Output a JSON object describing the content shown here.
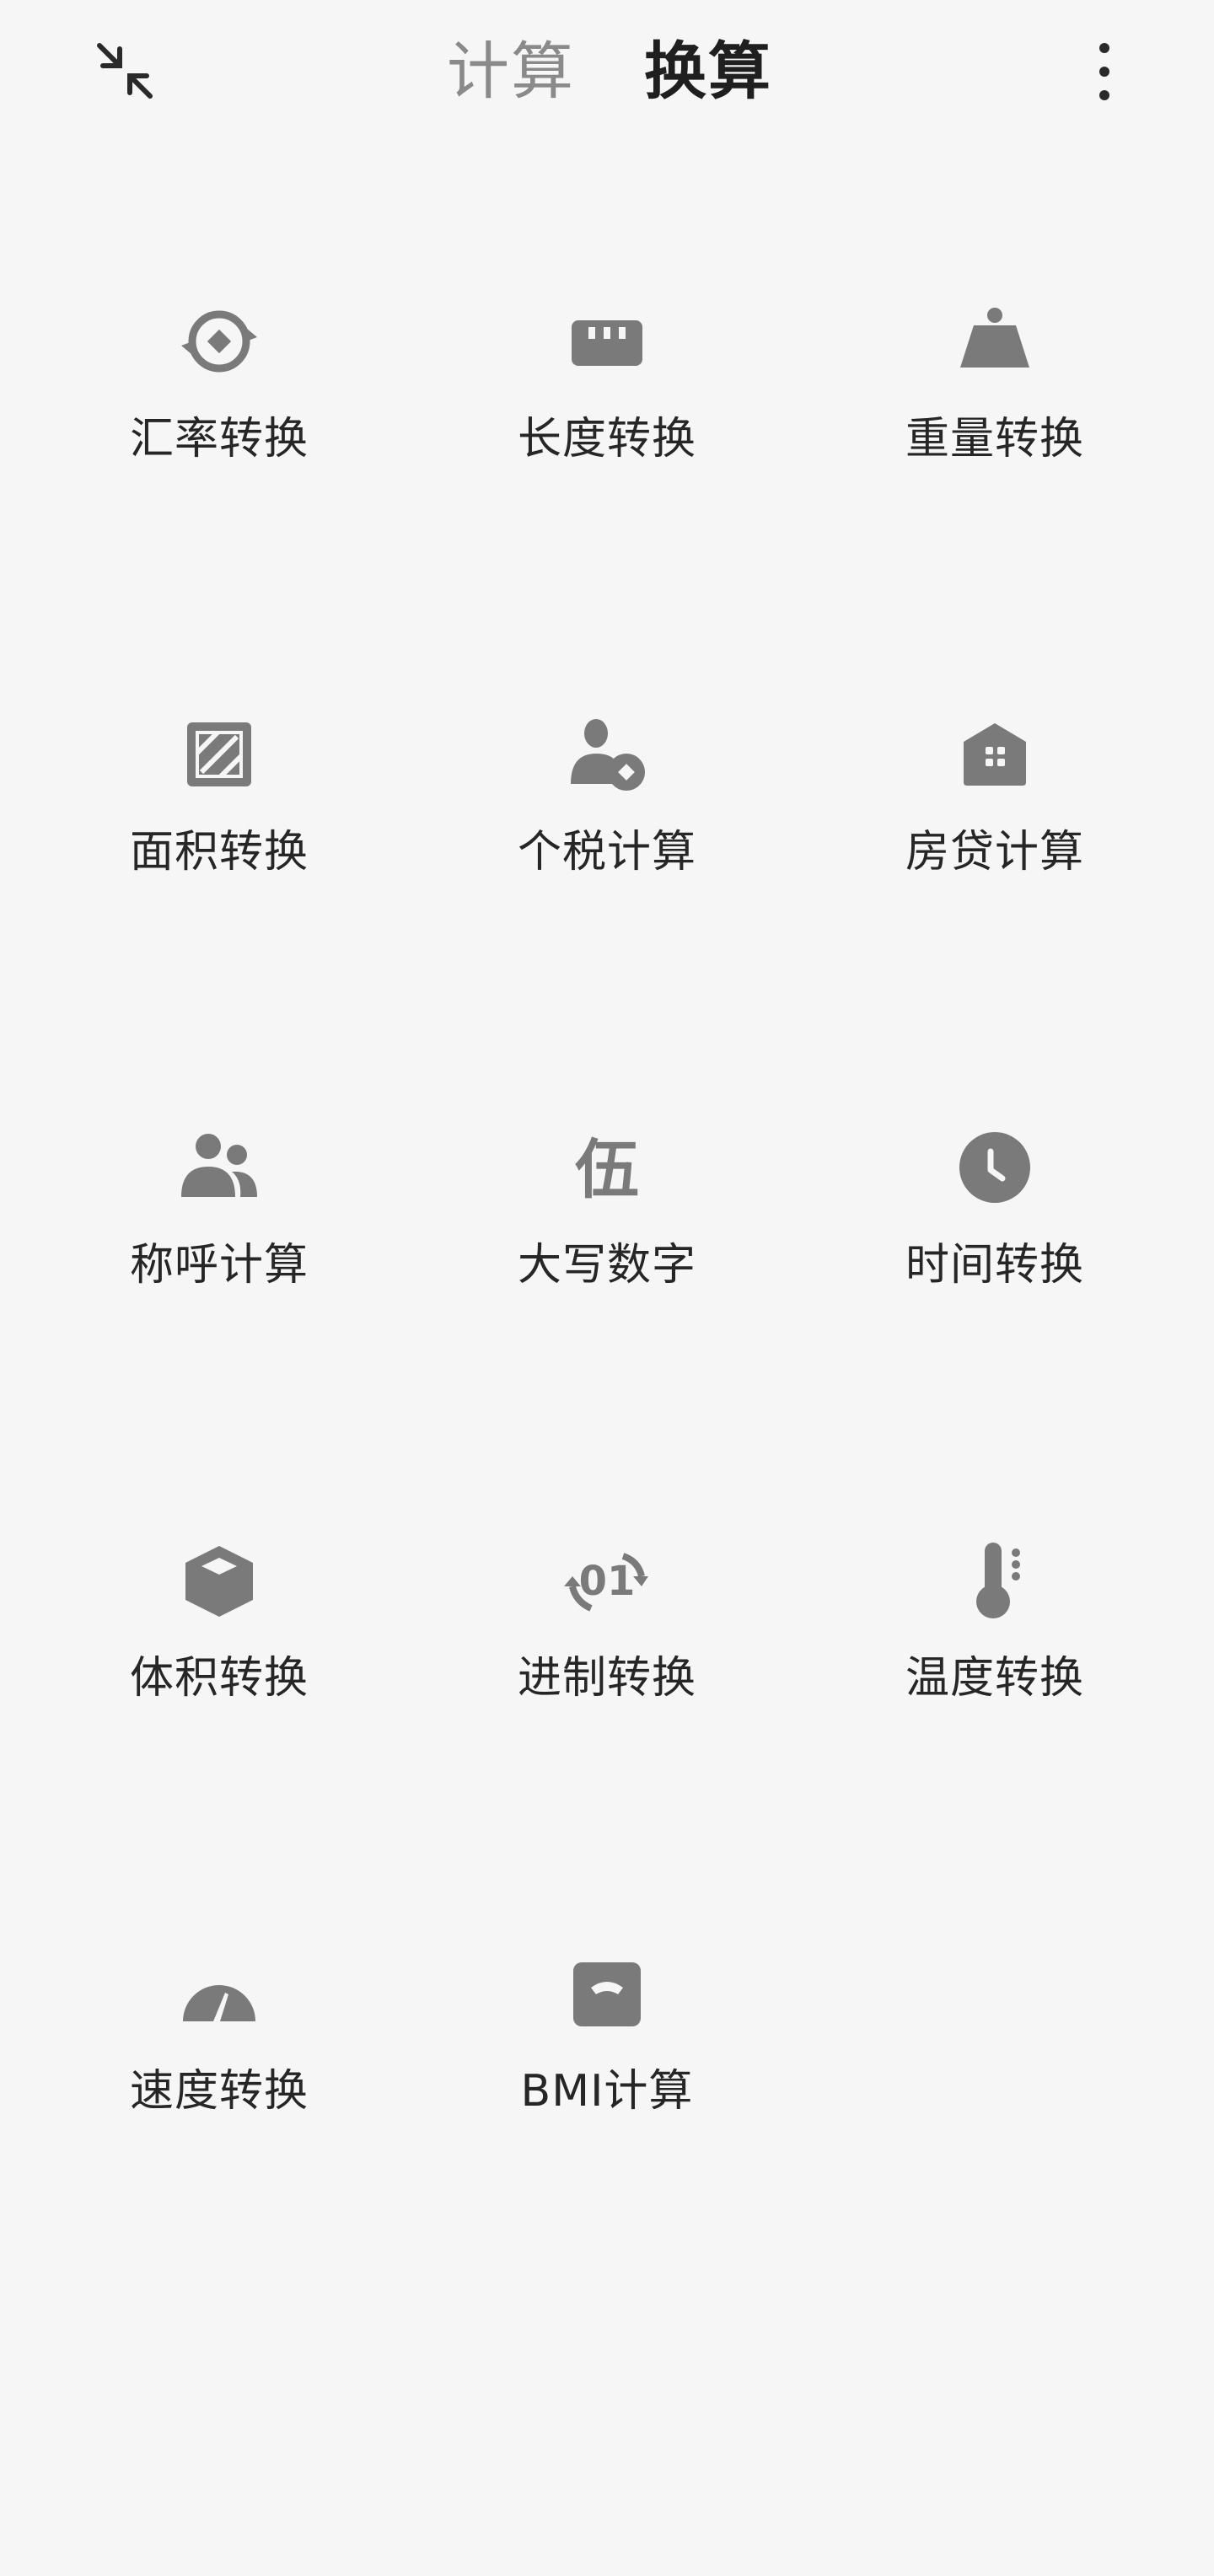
{
  "header": {
    "tabs": [
      {
        "label": "计算",
        "active": false
      },
      {
        "label": "换算",
        "active": true
      }
    ]
  },
  "icon_color": "#7a7a7a",
  "tools": [
    {
      "label": "汇率转换",
      "icon": "currency-exchange-icon"
    },
    {
      "label": "长度转换",
      "icon": "ruler-icon"
    },
    {
      "label": "重量转换",
      "icon": "weight-icon"
    },
    {
      "label": "面积转换",
      "icon": "area-icon"
    },
    {
      "label": "个税计算",
      "icon": "person-tax-icon"
    },
    {
      "label": "房贷计算",
      "icon": "house-icon"
    },
    {
      "label": "称呼计算",
      "icon": "people-icon"
    },
    {
      "label": "大写数字",
      "icon": "chinese-numeral-icon"
    },
    {
      "label": "时间转换",
      "icon": "clock-icon"
    },
    {
      "label": "体积转换",
      "icon": "cube-icon"
    },
    {
      "label": "进制转换",
      "icon": "number-base-icon"
    },
    {
      "label": "温度转换",
      "icon": "thermometer-icon"
    },
    {
      "label": "速度转换",
      "icon": "speedometer-icon"
    },
    {
      "label": "BMI计算",
      "icon": "bmi-scale-icon"
    }
  ],
  "numeral_glyph": "伍",
  "base_glyph": "01"
}
